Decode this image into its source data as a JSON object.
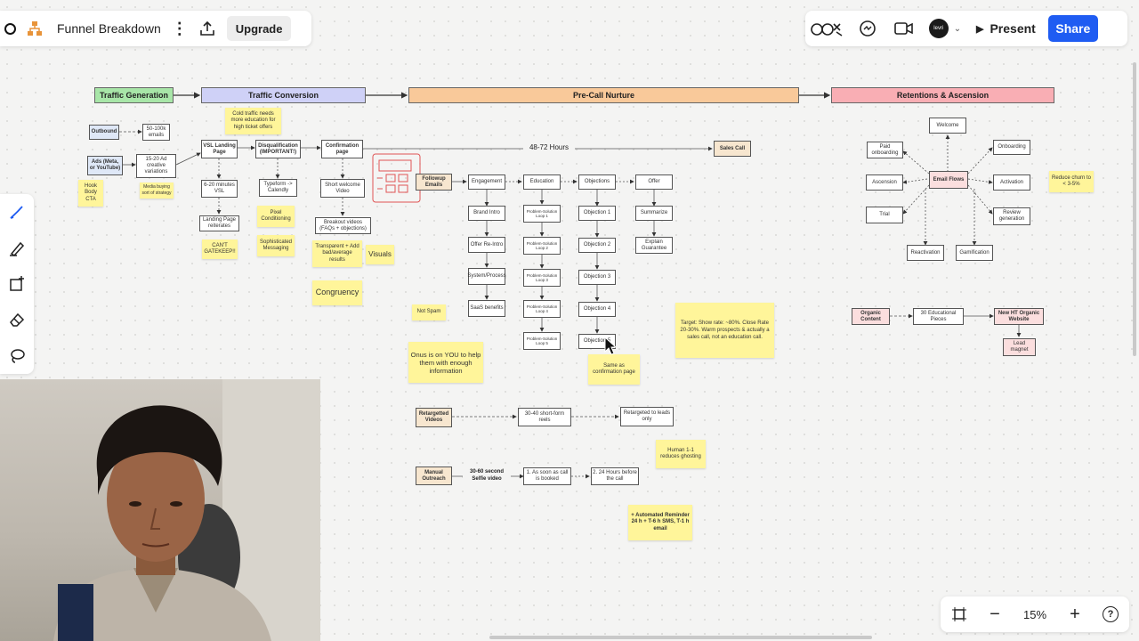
{
  "app": {
    "board_title": "Funnel Breakdown",
    "upgrade_label": "Upgrade",
    "present_label": "Present",
    "share_label": "Share",
    "user_avatar": "levri",
    "collab_icon": "collaborators-icon",
    "zoom": "15%"
  },
  "stages": {
    "traffic_generation": "Traffic Generation",
    "traffic_conversion": "Traffic Conversion",
    "precall": "Pre-Call Nurture",
    "retention": "Retentions & Ascension"
  },
  "tg": {
    "outbound": "Outbound",
    "emails": "50-100k emails",
    "ads": "Ads (Meta, or YouTube)",
    "creatives": "15-20 Ad creative variations",
    "hook": "Hook Body CTA",
    "media": "Media buying sort of strategy"
  },
  "tc": {
    "cold_note": "Cold traffic needs more education for high ticket offers",
    "vsl": "VSL Landing Page",
    "disq": "Disqualification (IMPORTANT!)",
    "confirm": "Confirmation page",
    "vsl_len": "6-20 minutes VSL",
    "typeform": "Typeform -> Calendly",
    "welcome_video": "Short welcome Video",
    "landing_reiterate": "Landing Page reiterates",
    "pixel": "Pixel Conditioning",
    "breakout": "Breakout videos (FAQs + objections)",
    "gatekeep": "CAN'T GATEKEEP!!",
    "soph": "Sophisticated Messaging",
    "transparent": "Transparent + Add bad/average results",
    "visuals": "Visuals",
    "congruency": "Congruency"
  },
  "pcn": {
    "hours": "48-72 Hours",
    "sales_call": "Sales Call",
    "followup": "Followup Emails",
    "engagement": "Engagement",
    "education": "Education",
    "objections": "Objections",
    "offer": "Offer",
    "brand_intro": "Brand Intro",
    "offer_reintro": "Offer Re-Intro",
    "system": "System/Process",
    "saas": "SaaS benefits",
    "psl1": "Problem-Solution Loop 1",
    "psl2": "Problem-Solution Loop 2",
    "psl3": "Problem-Solution Loop 3",
    "psl4": "Problem-Solution Loop 4",
    "psl5": "Problem-Solution Loop 5",
    "obj1": "Objection 1",
    "obj2": "Objection 2",
    "obj3": "Objection 3",
    "obj4": "Objection 4",
    "obj5": "Objection 5",
    "summarize": "Summarize",
    "guarantee": "Explain Guarantee",
    "not_spam": "Not Spam",
    "onus": "Onus is on YOU to help them with enough information",
    "same_as": "Same as confirmation page",
    "target": "Target: Show rate: ~80%. Close Rate 20-30%. Warm prospects & actually a sales call, not an education call.",
    "retargeted": "Retargetted Videos",
    "reels": "30-40 short-form reels",
    "retargeted_leads": "Retargeted to leads only",
    "human": "Human 1-1 reduces ghosting",
    "manual": "Manual Outreach",
    "selfie": "30-60 second Selfie video",
    "asap": "1. As soon as call is booked",
    "before": "2. 24 Hours before the call",
    "automated": "+ Automated Reminder 24 h + T-6 h SMS, T-1 h email"
  },
  "ra": {
    "welcome": "Welcome",
    "paid": "Paid onboarding",
    "onboarding": "Onboarding",
    "ascension": "Ascension",
    "email_flows": "Email Flows",
    "activation": "Activation",
    "trial": "Trial",
    "review": "Review generation",
    "reactivation": "Reactivation",
    "gamification": "Gamification",
    "churn": "Reduce churn to < 3-5%",
    "organic": "Organic Content",
    "edu_pieces": "30 Educational Pieces",
    "website": "New HT Organic Website",
    "lead_magnet": "Lead magnet"
  }
}
